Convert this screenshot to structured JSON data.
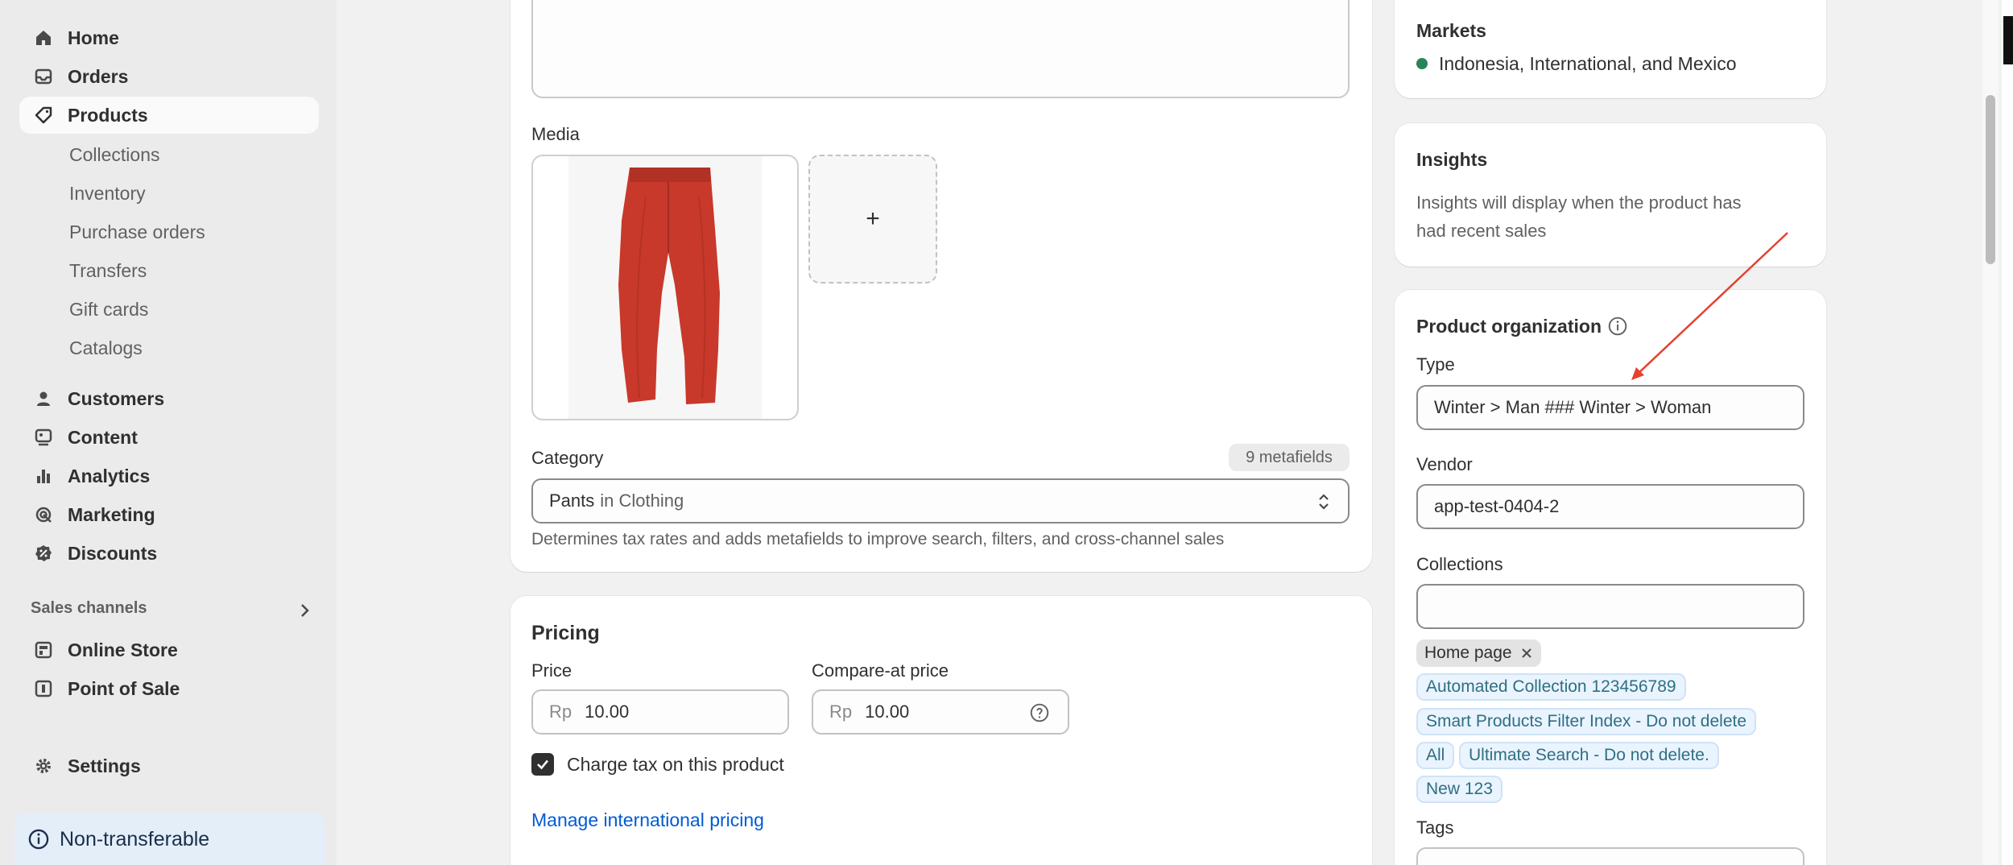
{
  "sidebar": {
    "main_items": [
      {
        "label": "Home",
        "icon": "home-icon"
      },
      {
        "label": "Orders",
        "icon": "inbox-icon"
      },
      {
        "label": "Products",
        "icon": "tag-icon"
      }
    ],
    "product_sub_items": [
      "Collections",
      "Inventory",
      "Purchase orders",
      "Transfers",
      "Gift cards",
      "Catalogs"
    ],
    "other_items": [
      {
        "label": "Customers",
        "icon": "person-icon"
      },
      {
        "label": "Content",
        "icon": "content-icon"
      },
      {
        "label": "Analytics",
        "icon": "bar-chart-icon"
      },
      {
        "label": "Marketing",
        "icon": "target-icon"
      },
      {
        "label": "Discounts",
        "icon": "discount-icon"
      }
    ],
    "sales_channels_label": "Sales channels",
    "channels": [
      {
        "label": "Online Store",
        "icon": "store-icon"
      },
      {
        "label": "Point of Sale",
        "icon": "pos-icon"
      }
    ],
    "settings_label": "Settings",
    "banner_label": "Non-transferable"
  },
  "main": {
    "media_label": "Media",
    "media_add": "+",
    "category_label": "Category",
    "category_badge": "9 metafields",
    "category_value_main": "Pants",
    "category_value_sub": "in Clothing",
    "category_help": "Determines tax rates and adds metafields to improve search, filters, and cross-channel sales",
    "pricing": {
      "title": "Pricing",
      "price_label": "Price",
      "price_prefix": "Rp",
      "price_value": "10.00",
      "compare_label": "Compare-at price",
      "compare_prefix": "Rp",
      "compare_value": "10.00",
      "charge_tax_label": "Charge tax on this product",
      "charge_tax_checked": true,
      "manage_link": "Manage international pricing"
    }
  },
  "right": {
    "markets_title": "Markets",
    "markets_value": "Indonesia, International, and Mexico",
    "insights_title": "Insights",
    "insights_text_1": "Insights will display when the product has",
    "insights_text_2": "had recent sales",
    "org_title": "Product organization",
    "type_label": "Type",
    "type_value": "Winter > Man ### Winter > Woman",
    "vendor_label": "Vendor",
    "vendor_value": "app-test-0404-2",
    "collections_label": "Collections",
    "collections_value": "",
    "collection_tags": [
      {
        "label": "Home page",
        "kind": "plain"
      },
      {
        "label": "Automated Collection 123456789",
        "kind": "auto"
      },
      {
        "label": "Smart Products Filter Index - Do not delete",
        "kind": "auto"
      },
      {
        "label": "All",
        "kind": "auto"
      },
      {
        "label": "Ultimate Search - Do not delete.",
        "kind": "auto"
      },
      {
        "label": "New 123",
        "kind": "auto"
      }
    ],
    "tags_label": "Tags"
  },
  "colors": {
    "accent_link": "#005bd3",
    "market_dot": "#29845a",
    "annotation_arrow": "#e5412f"
  }
}
